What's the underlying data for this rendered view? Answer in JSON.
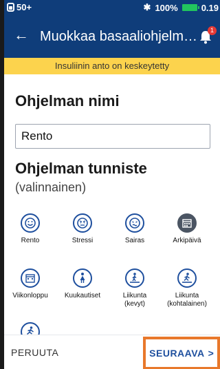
{
  "status": {
    "signal": "50+",
    "battery_pct": "100%",
    "insulin": "0.19"
  },
  "header": {
    "title": "Muokkaa basaaliohjelm…",
    "notification_count": "1"
  },
  "banner": {
    "text": "Insuliinin anto on keskeytetty"
  },
  "name_section": {
    "title": "Ohjelman nimi",
    "value": "Rento"
  },
  "tag_section": {
    "title": "Ohjelman tunniste",
    "subtitle": "(valinnainen)"
  },
  "tags": [
    {
      "label": "Rento",
      "icon": "smile-icon",
      "selected": false
    },
    {
      "label": "Stressi",
      "icon": "stressed-face-icon",
      "selected": false
    },
    {
      "label": "Sairas",
      "icon": "sick-face-icon",
      "selected": false
    },
    {
      "label": "Arkipäivä",
      "icon": "calendar-workday-icon",
      "selected": true
    },
    {
      "label": "Viikonloppu",
      "icon": "calendar-weekend-icon",
      "selected": false
    },
    {
      "label": "Kuukautiset",
      "icon": "female-icon",
      "selected": false
    },
    {
      "label": "Liikunta\n(kevyt)",
      "icon": "treadmill-light-icon",
      "selected": false
    },
    {
      "label": "Liikunta\n(kohtalainen)",
      "icon": "treadmill-moderate-icon",
      "selected": false
    },
    {
      "label": "",
      "icon": "running-icon",
      "selected": false
    }
  ],
  "footer": {
    "cancel": "PERUUTA",
    "next": "SEURAAVA"
  },
  "colors": {
    "header_bg": "#0f3d7a",
    "banner_bg": "#fcd34d",
    "accent_blue": "#1e4f9e",
    "highlight_orange": "#e8782b"
  }
}
